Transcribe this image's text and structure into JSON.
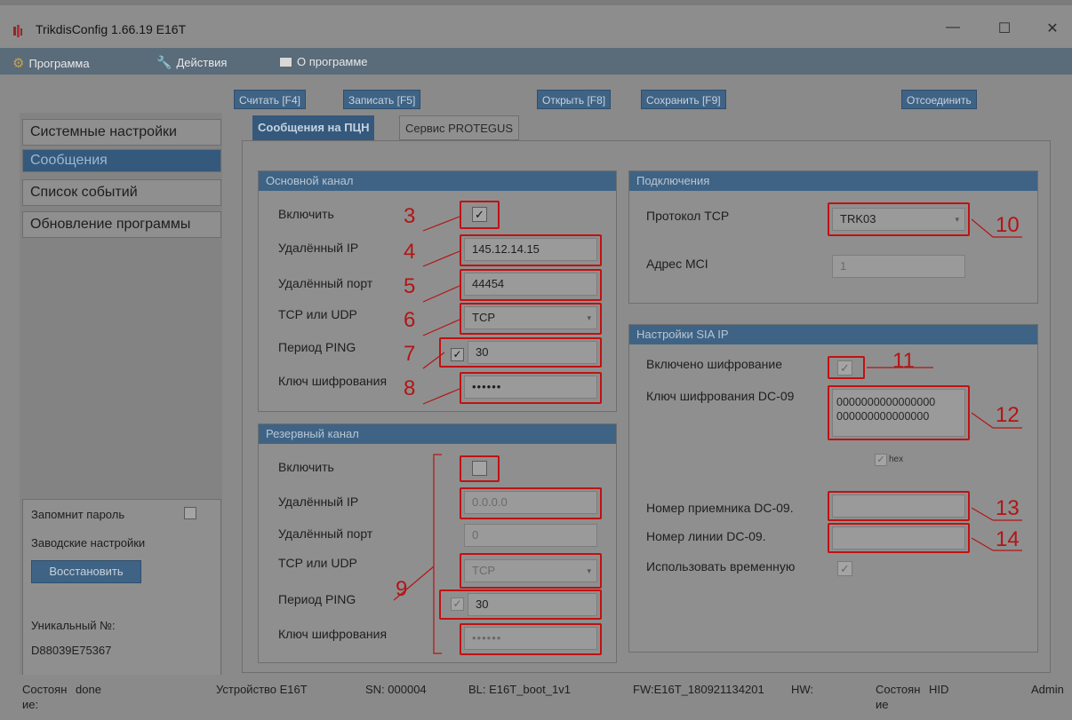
{
  "window": {
    "title": "TrikdisConfig 1.66.19  E16T",
    "minimize": "—",
    "maximize": "☐",
    "close": "✕"
  },
  "menu": [
    {
      "label": "Программа",
      "icon": "gear-icon"
    },
    {
      "label": "Действия",
      "icon": "wrench-icon"
    },
    {
      "label": "О программе",
      "icon": "book-icon"
    }
  ],
  "toolbar": {
    "read": "Считать [F4]",
    "write": "Записать [F5]",
    "open": "Открыть [F8]",
    "save": "Сохранить [F9]",
    "disconnect": "Отсоединить"
  },
  "sidebar": {
    "items": [
      {
        "label": "Системные настройки"
      },
      {
        "label": "Сообщения"
      },
      {
        "label": "Список событий"
      },
      {
        "label": "Обновление программы"
      }
    ],
    "remember_password": "Запомнит пароль",
    "factory_settings": "Заводские настройки",
    "restore": "Восстановить",
    "unique_label": "Уникальный №:",
    "unique_value": "D88039E75367"
  },
  "tabs": [
    {
      "label": "Сообщения на ПЦН"
    },
    {
      "label": "Сервис PROTEGUS"
    }
  ],
  "main_channel": {
    "title": "Основной канал",
    "enable_label": "Включить",
    "enable_check": "✓",
    "ip_label": "Удалённый IP",
    "ip_value": "145.12.14.15",
    "port_label": "Удалённый порт",
    "port_value": "44454",
    "proto_label": "TCP или UDP",
    "proto_value": "TCP",
    "ping_label": "Период PING",
    "ping_check": "✓",
    "ping_value": "30",
    "key_label": "Ключ шифрования",
    "key_value": "••••••"
  },
  "backup_channel": {
    "title": "Резервный канал",
    "enable_label": "Включить",
    "ip_label": "Удалённый IP",
    "ip_value": "0.0.0.0",
    "port_label": "Удалённый порт",
    "port_value": "0",
    "proto_label": "TCP или UDP",
    "proto_value": "TCP",
    "ping_label": "Период PING",
    "ping_check": "✓",
    "ping_value": "30",
    "key_label": "Ключ шифрования",
    "key_value": "••••••"
  },
  "connections": {
    "title": "Подключения",
    "proto_label": "Протокол TCP",
    "proto_value": "TRK03",
    "mci_label": "Адрес MCI",
    "mci_value": "1"
  },
  "sia": {
    "title": "Настройки SIA IP",
    "enc_label": "Включено шифрование",
    "enc_check": "✓",
    "key_label": "Ключ шифрования DC-09",
    "key_line1": "0000000000000000",
    "key_line2": "000000000000000",
    "hex_check": "✓",
    "hex_label": "hex",
    "receiver_label": "Номер приемника DC-09.",
    "line_label": "Номер линии DC-09.",
    "time_label": "Использовать временную",
    "time_check": "✓"
  },
  "annotations": [
    "3",
    "4",
    "5",
    "6",
    "7",
    "8",
    "9",
    "10",
    "11",
    "12",
    "13",
    "14"
  ],
  "status": {
    "state_label_1": "Состоян",
    "state_label_2": "ие:",
    "state_value": "done",
    "device": "Устройство E16T",
    "sn": "SN: 000004",
    "bl": "BL: E16T_boot_1v1",
    "fw": "FW:E16T_180921134201",
    "hw": "HW:",
    "state2_label_1": "Состоян",
    "state2_label_2": "ие",
    "state2_value": "HID",
    "user": "Admin"
  },
  "colors": {
    "accent_blue": "#34597c",
    "annotation_red": "#c01212"
  }
}
